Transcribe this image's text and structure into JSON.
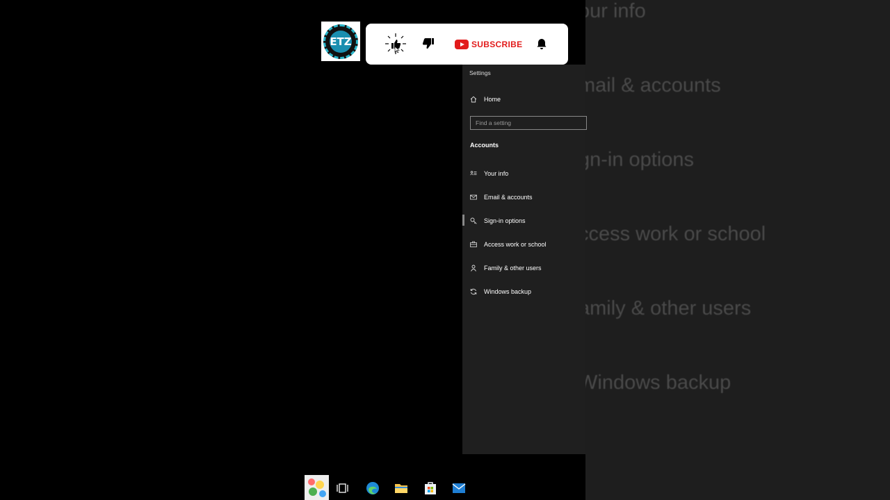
{
  "background_zoom": {
    "items": [
      "our info",
      "mail & accounts",
      "gn-in options",
      "ccess work or school",
      "amily & other users",
      "Windows backup"
    ]
  },
  "overlay": {
    "subscribe_label": "SUBSCRIBE",
    "channel_logo_text": "ETZ",
    "accent_color": "#e21b1b"
  },
  "settings": {
    "window_title": "Settings",
    "home_label": "Home",
    "search_placeholder": "Find a setting",
    "section_header": "Accounts",
    "nav_items": [
      {
        "label": "Your info",
        "icon": "contact-card-icon"
      },
      {
        "label": "Email & accounts",
        "icon": "mail-icon"
      },
      {
        "label": "Sign-in options",
        "icon": "key-icon"
      },
      {
        "label": "Access work or school",
        "icon": "briefcase-icon"
      },
      {
        "label": "Family & other users",
        "icon": "person-icon"
      },
      {
        "label": "Windows backup",
        "icon": "sync-icon"
      }
    ],
    "selected_item": "Sign-in options"
  },
  "taskbar": {
    "icons": [
      "paint-icon",
      "task-view-icon",
      "edge-icon",
      "file-explorer-icon",
      "store-icon",
      "mail-icon"
    ]
  }
}
